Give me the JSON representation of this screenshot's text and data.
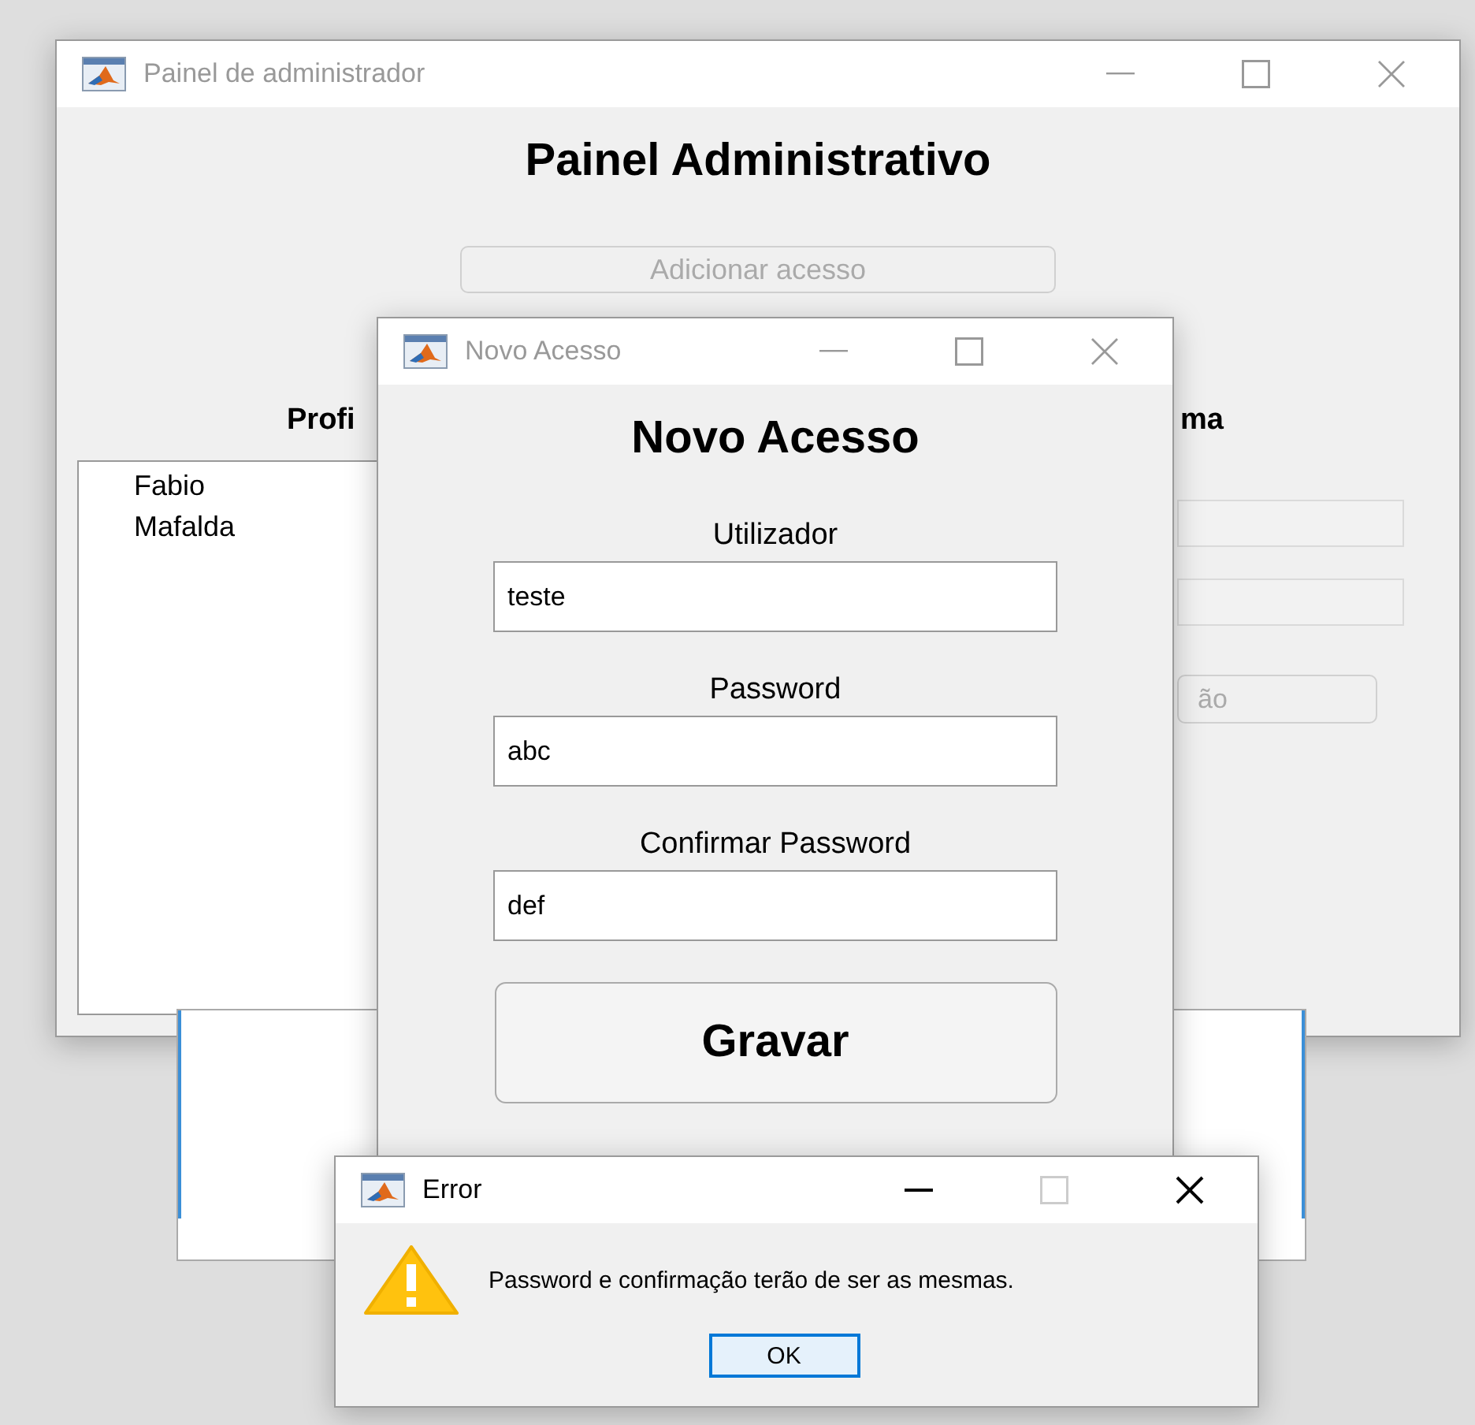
{
  "admin_window": {
    "title": "Painel de administrador",
    "active": false,
    "heading": "Painel Administrativo",
    "add_button": {
      "label": "Adicionar acesso",
      "disabled": true
    },
    "profiles_label": "Profi",
    "profiles": [
      {
        "label": "Fabio",
        "selected": false
      },
      {
        "label": "Mafalda",
        "selected": false
      }
    ],
    "right_label": "ma",
    "right_button": {
      "label": "ão",
      "disabled": true
    }
  },
  "new_access_dialog": {
    "title": "Novo Acesso",
    "active": false,
    "heading": "Novo Acesso",
    "fields": [
      {
        "label": "Utilizador",
        "value": "teste"
      },
      {
        "label": "Password",
        "value": "abc"
      },
      {
        "label": "Confirmar Password",
        "value": "def"
      }
    ],
    "save_button": {
      "label": "Gravar"
    }
  },
  "error_dialog": {
    "title": "Error",
    "active": true,
    "maximize_disabled": true,
    "message": "Password e confirmação terão de ser as mesmas.",
    "ok_button": {
      "label": "OK",
      "focused": true
    }
  }
}
